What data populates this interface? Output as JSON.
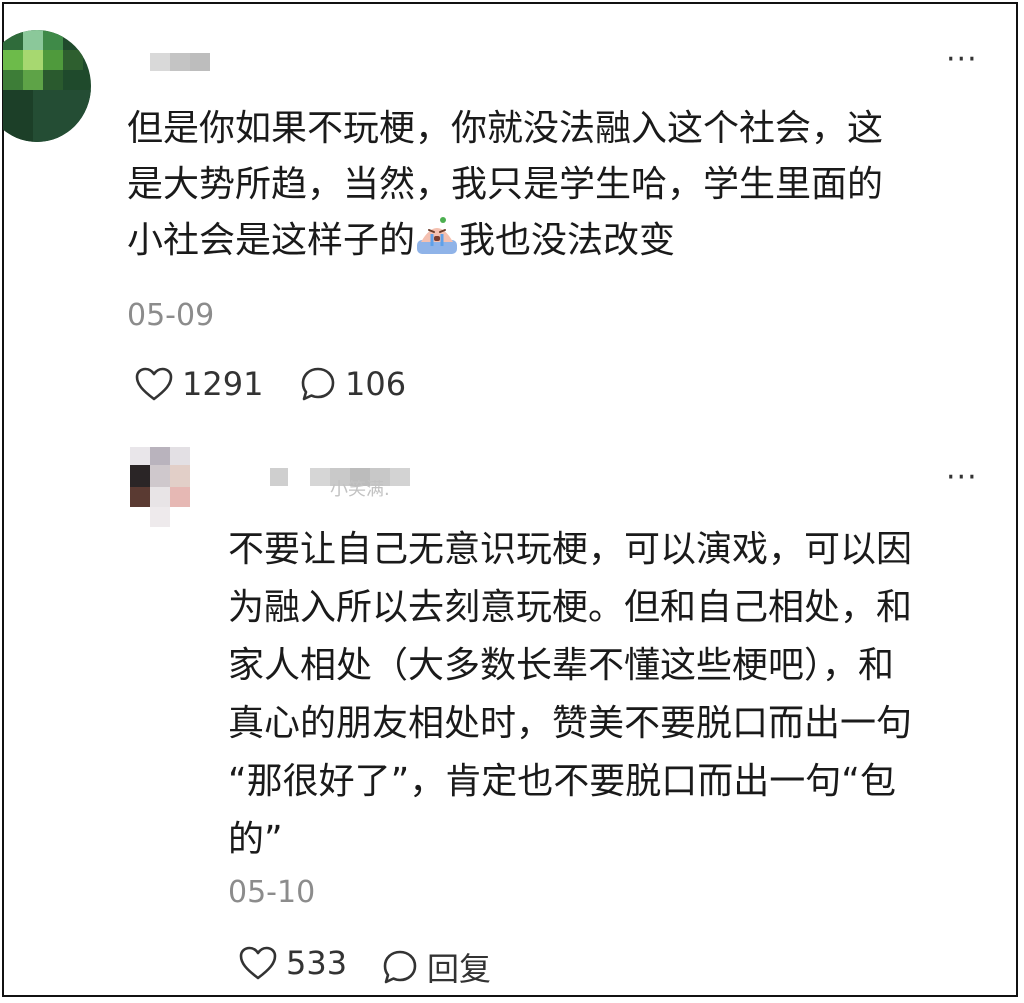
{
  "comment": {
    "text_line1": "但是你如果不玩梗，你就没法融入这个社会，这",
    "text_line2": "是大势所趋，当然，我只是学生哈，学生里面的",
    "text_line3_before": "小社会是这样子的",
    "emoji": "crying-face-emoji",
    "text_line3_after": "我也没法改变",
    "date": "05-09",
    "likes": "1291",
    "replies": "106",
    "more": "···"
  },
  "reply": {
    "username_visible": "小笑满.",
    "text_line1": "不要让自己无意识玩梗，可以演戏，可以因",
    "text_line2": "为融入所以去刻意玩梗。但和自己相处，和",
    "text_line3": "家人相处（大多数长辈不懂这些梗吧），和",
    "text_line4": "真心的朋友相处时，赞美不要脱口而出一句",
    "text_line5": "“那很好了”，肯定也不要脱口而出一句“包",
    "text_line6": "的”",
    "date": "05-10",
    "likes": "533",
    "reply_label": "回复",
    "more": "···"
  },
  "icons": {
    "like": "heart-outline-icon",
    "comment": "speech-bubble-icon"
  },
  "colors": {
    "text": "#1a1a1a",
    "meta": "#8c8c8c",
    "frame": "#111111"
  }
}
